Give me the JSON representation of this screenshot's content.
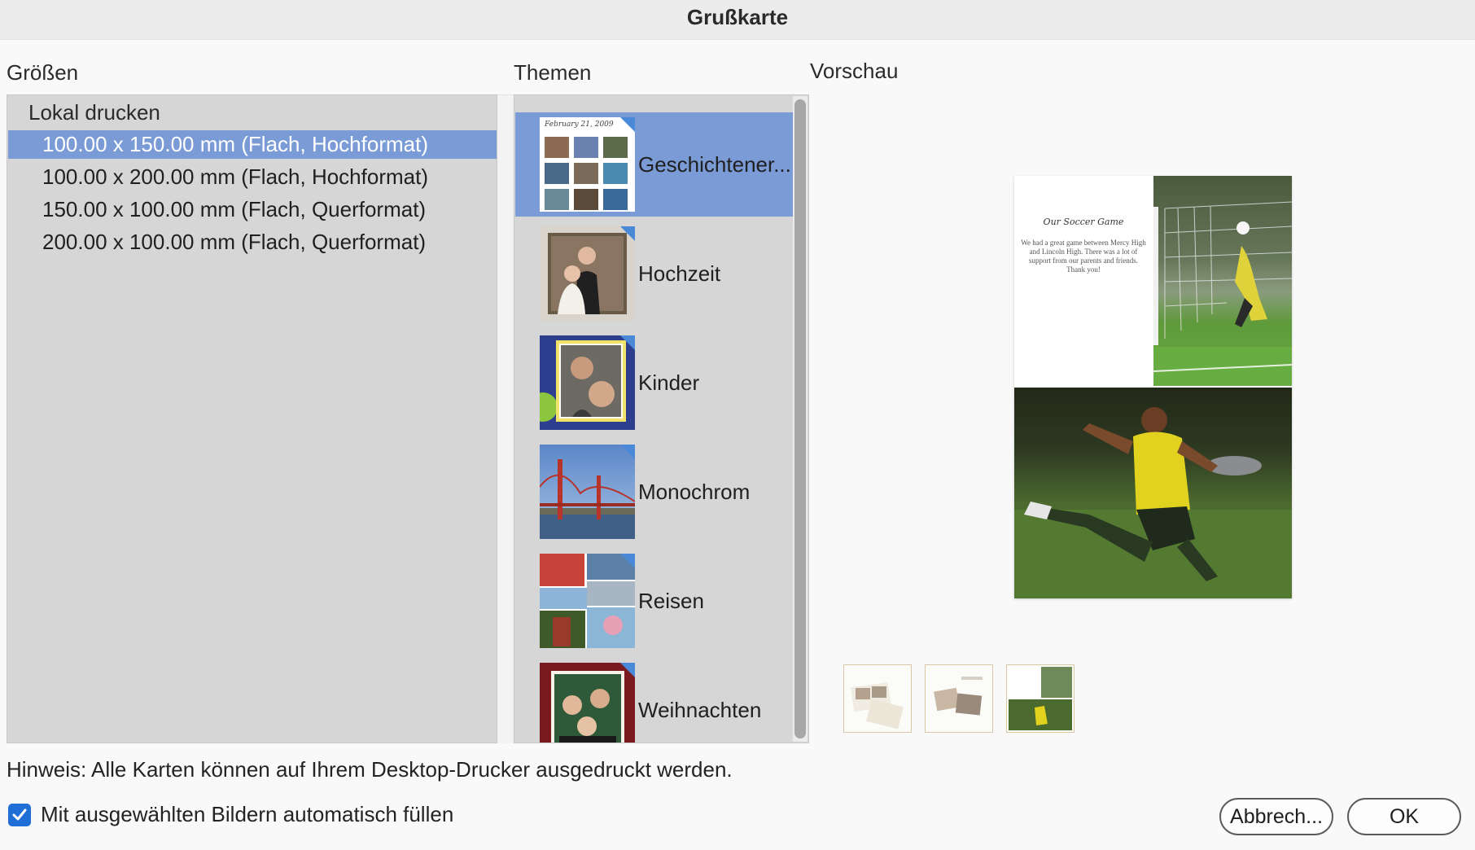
{
  "window": {
    "title": "Grußkarte"
  },
  "labels": {
    "sizes": "Größen",
    "themes": "Themen",
    "preview": "Vorschau"
  },
  "sizes": {
    "group": "Lokal drucken",
    "items": [
      {
        "label": "100.00 x 150.00 mm (Flach, Hochformat)",
        "selected": true
      },
      {
        "label": "100.00 x 200.00 mm (Flach, Hochformat)",
        "selected": false
      },
      {
        "label": "150.00 x 100.00 mm (Flach, Querformat)",
        "selected": false
      },
      {
        "label": "200.00 x 100.00 mm (Flach, Querformat)",
        "selected": false
      }
    ]
  },
  "themes": {
    "items": [
      {
        "label": "Geschichtener...",
        "selected": true,
        "thumb_caption": "February 21, 2009"
      },
      {
        "label": "Hochzeit",
        "selected": false
      },
      {
        "label": "Kinder",
        "selected": false
      },
      {
        "label": "Monochrom",
        "selected": false
      },
      {
        "label": "Reisen",
        "selected": false
      },
      {
        "label": "Weihnachten",
        "selected": false
      }
    ]
  },
  "preview": {
    "card_title": "Our Soccer Game",
    "card_body": "We had a great game between Mercy High and Lincoln High. There was a lot of support from our parents and friends. Thank you!"
  },
  "footer": {
    "note": "Hinweis: Alle Karten können auf Ihrem Desktop-Drucker ausgedruckt werden.",
    "autofill_label": "Mit ausgewählten Bildern automatisch füllen",
    "autofill_checked": true,
    "cancel_label": "Abbrech...",
    "ok_label": "OK"
  },
  "colors": {
    "selection": "#7a9bd6",
    "checkbox": "#1f6fd6",
    "panel": "#d6d6d6"
  }
}
